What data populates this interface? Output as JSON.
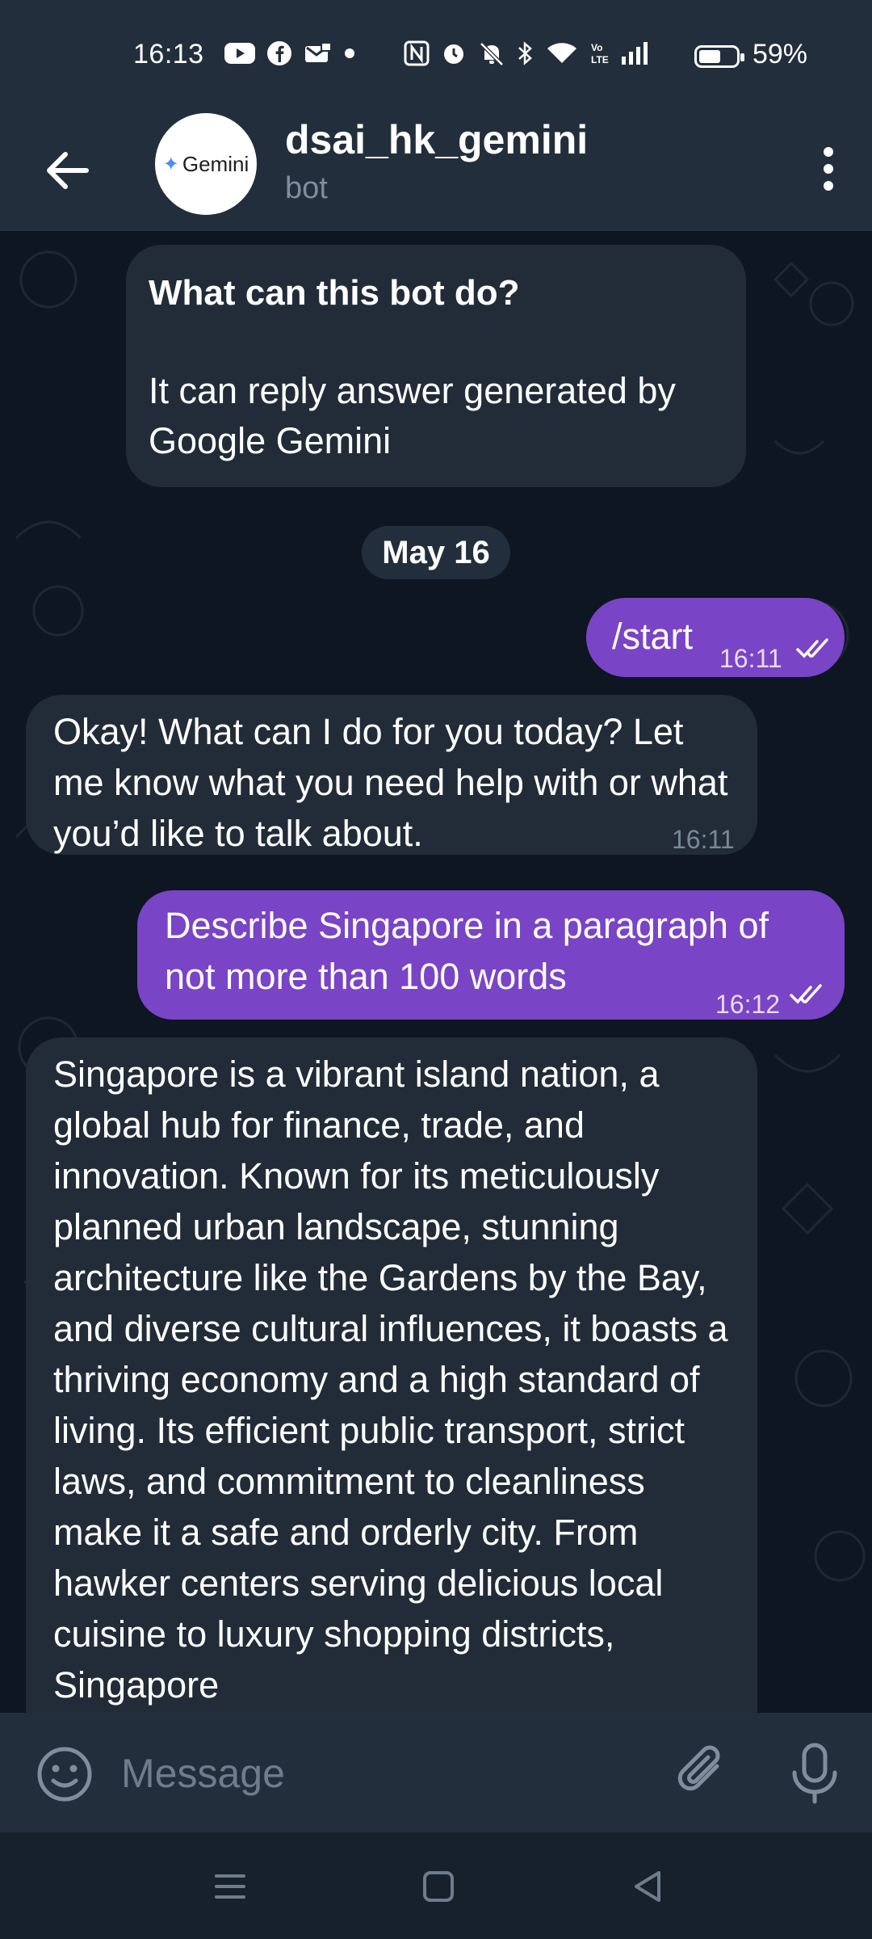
{
  "status_bar": {
    "time": "16:13",
    "battery_percent": "59%",
    "battery_level": 0.59,
    "icons_left": [
      "youtube-icon",
      "facebook-icon",
      "mail-icon",
      "dot-icon"
    ],
    "icons_right": [
      "nfc-icon",
      "alarm-icon",
      "mute-icon",
      "bluetooth-icon",
      "wifi-icon",
      "volte-icon",
      "signal-icon"
    ]
  },
  "header": {
    "title": "dsai_hk_gemini",
    "subtitle": "bot",
    "avatar_text": "Gemini"
  },
  "info_card": {
    "title": "What can this bot do?",
    "body": "It can reply answer generated by Google Gemini"
  },
  "date_separator": "May 16",
  "messages": [
    {
      "direction": "out",
      "text": "/start",
      "time": "16:11",
      "status": "read"
    },
    {
      "direction": "in",
      "text": "Okay! What can I do for you today? Let me know what you need help with or what you’d like to talk about.",
      "time": "16:11"
    },
    {
      "direction": "out",
      "text": "Describe Singapore in a paragraph of not more than 100 words",
      "time": "16:12",
      "status": "read"
    },
    {
      "direction": "in",
      "text": "Singapore is a vibrant island nation, a global hub for finance, trade, and innovation. Known for its meticulously planned urban landscape, stunning architecture like the Gardens by the Bay, and diverse cultural influences, it boasts a thriving economy and a high standard of living. Its efficient public transport, strict laws, and commitment to cleanliness make it a safe and orderly city. From hawker centers serving delicious local cuisine to luxury shopping districts, Singapore"
    }
  ],
  "composer": {
    "placeholder": "Message"
  },
  "colors": {
    "background": "#0e1621",
    "header": "#232e3c",
    "incoming_bubble": "#222c38",
    "outgoing_bubble": "#7a44c6",
    "muted_text": "#7f8d9c"
  }
}
